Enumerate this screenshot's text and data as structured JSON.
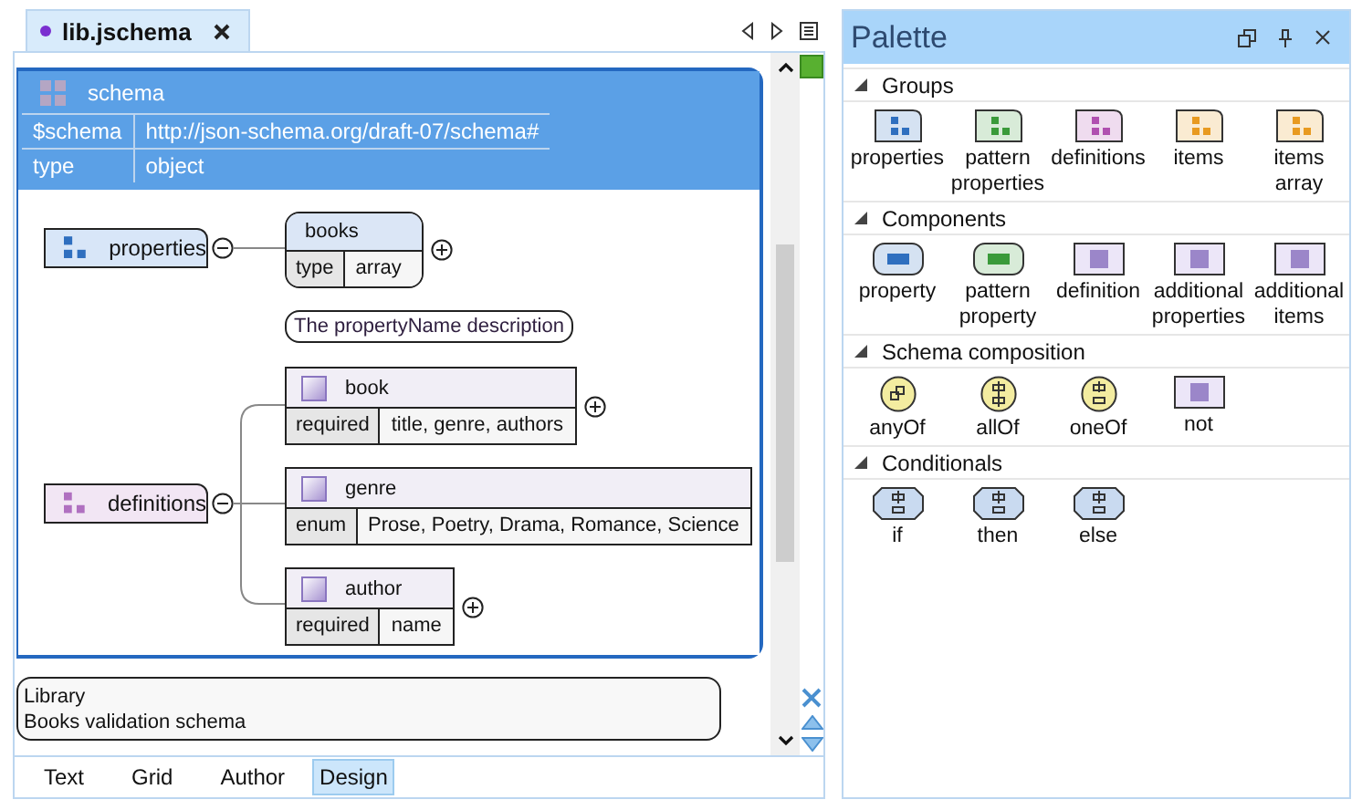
{
  "editor_tab": {
    "label": "lib.jschema",
    "selected": true
  },
  "schema": {
    "title": "schema",
    "rows": [
      {
        "key": "$schema",
        "value": "http://json-schema.org/draft-07/schema#"
      },
      {
        "key": "type",
        "value": "object"
      }
    ]
  },
  "properties_group": {
    "label": "properties",
    "expanded": true,
    "property": {
      "name": "books",
      "rows": [
        {
          "key": "type",
          "value": "array"
        }
      ],
      "description": "The propertyName description"
    }
  },
  "definitions_group": {
    "label": "definitions",
    "expanded": true,
    "children": [
      {
        "name": "book",
        "rows": [
          {
            "key": "required",
            "value": "title, genre, authors"
          }
        ],
        "expandable": true
      },
      {
        "name": "genre",
        "rows": [
          {
            "key": "enum",
            "value": "Prose, Poetry, Drama, Romance, Science"
          }
        ],
        "expandable": false
      },
      {
        "name": "author",
        "rows": [
          {
            "key": "required",
            "value": "name"
          }
        ],
        "expandable": true
      }
    ]
  },
  "annotation": {
    "lines": [
      "Library",
      "Books validation schema"
    ]
  },
  "bottom_tabs": [
    {
      "label": "Text",
      "selected": false
    },
    {
      "label": "Grid",
      "selected": false
    },
    {
      "label": "Author",
      "selected": false
    },
    {
      "label": "Design",
      "selected": true
    }
  ],
  "palette": {
    "title": "Palette",
    "sections": [
      {
        "title": "Groups",
        "expanded": true,
        "items": [
          {
            "label": "properties",
            "kind": "group",
            "color": "#2f6fbf"
          },
          {
            "label": "pattern properties",
            "kind": "group",
            "color": "#3a9a3a"
          },
          {
            "label": "definitions",
            "kind": "group",
            "color": "#b050b0"
          },
          {
            "label": "items",
            "kind": "group",
            "color": "#e89a20"
          },
          {
            "label": "items array",
            "kind": "group",
            "color": "#e89a20"
          }
        ]
      },
      {
        "title": "Components",
        "expanded": true,
        "items": [
          {
            "label": "property",
            "kind": "property",
            "color": "#2f6fbf"
          },
          {
            "label": "pattern property",
            "kind": "property",
            "color": "#3a9a3a"
          },
          {
            "label": "definition",
            "kind": "definition",
            "color": "#9b86c9"
          },
          {
            "label": "additional properties",
            "kind": "definition",
            "color": "#9b86c9"
          },
          {
            "label": "additional items",
            "kind": "definition",
            "color": "#9b86c9"
          }
        ]
      },
      {
        "title": "Schema composition",
        "expanded": true,
        "items": [
          {
            "label": "anyOf",
            "kind": "any",
            "color": "#f3eca0"
          },
          {
            "label": "allOf",
            "kind": "all",
            "color": "#f3eca0"
          },
          {
            "label": "oneOf",
            "kind": "one",
            "color": "#f3eca0"
          },
          {
            "label": "not",
            "kind": "definition",
            "color": "#9b86c9"
          }
        ]
      },
      {
        "title": "Conditionals",
        "expanded": true,
        "items": [
          {
            "label": "if",
            "kind": "conditional",
            "color": "#c9daf0"
          },
          {
            "label": "then",
            "kind": "conditional",
            "color": "#c9daf0"
          },
          {
            "label": "else",
            "kind": "conditional",
            "color": "#c9daf0"
          }
        ]
      }
    ]
  }
}
